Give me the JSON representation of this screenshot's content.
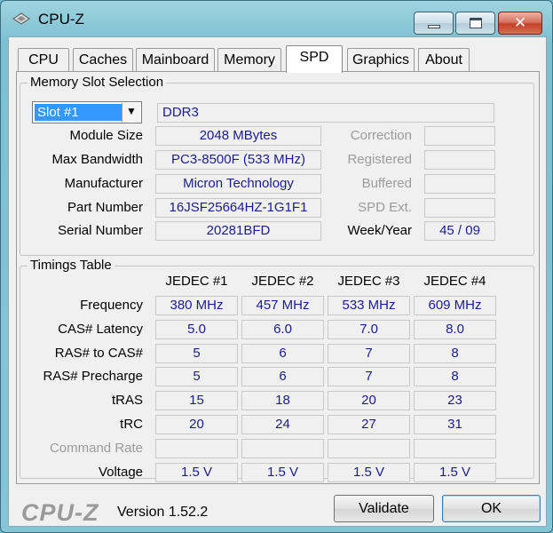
{
  "window": {
    "title": "CPU-Z"
  },
  "tabs": [
    "CPU",
    "Caches",
    "Mainboard",
    "Memory",
    "SPD",
    "Graphics",
    "About"
  ],
  "active_tab": "SPD",
  "slot_selection": {
    "group_title": "Memory Slot Selection",
    "slot_value": "Slot #1",
    "memory_type": "DDR3",
    "rows": [
      {
        "label": "Module Size",
        "value": "2048 MBytes"
      },
      {
        "label": "Max Bandwidth",
        "value": "PC3-8500F (533 MHz)"
      },
      {
        "label": "Manufacturer",
        "value": "Micron Technology"
      },
      {
        "label": "Part Number",
        "value": "16JSF25664HZ-1G1F1"
      },
      {
        "label": "Serial Number",
        "value": "20281BFD"
      }
    ],
    "right_rows": [
      {
        "label": "Correction",
        "value": ""
      },
      {
        "label": "Registered",
        "value": ""
      },
      {
        "label": "Buffered",
        "value": ""
      },
      {
        "label": "SPD Ext.",
        "value": ""
      },
      {
        "label": "Week/Year",
        "value": "45 / 09"
      }
    ]
  },
  "timings": {
    "group_title": "Timings Table",
    "columns": [
      "JEDEC #1",
      "JEDEC #2",
      "JEDEC #3",
      "JEDEC #4"
    ],
    "rows": [
      {
        "label": "Frequency",
        "values": [
          "380 MHz",
          "457 MHz",
          "533 MHz",
          "609 MHz"
        ]
      },
      {
        "label": "CAS# Latency",
        "values": [
          "5.0",
          "6.0",
          "7.0",
          "8.0"
        ]
      },
      {
        "label": "RAS# to CAS#",
        "values": [
          "5",
          "6",
          "7",
          "8"
        ]
      },
      {
        "label": "RAS# Precharge",
        "values": [
          "5",
          "6",
          "7",
          "8"
        ]
      },
      {
        "label": "tRAS",
        "values": [
          "15",
          "18",
          "20",
          "23"
        ]
      },
      {
        "label": "tRC",
        "values": [
          "20",
          "24",
          "27",
          "31"
        ]
      },
      {
        "label": "Command Rate",
        "values": [
          "",
          "",
          "",
          ""
        ]
      },
      {
        "label": "Voltage",
        "values": [
          "1.5 V",
          "1.5 V",
          "1.5 V",
          "1.5 V"
        ]
      }
    ]
  },
  "footer": {
    "brand": "CPU-Z",
    "version": "Version 1.52.2",
    "validate_label": "Validate",
    "ok_label": "OK"
  }
}
